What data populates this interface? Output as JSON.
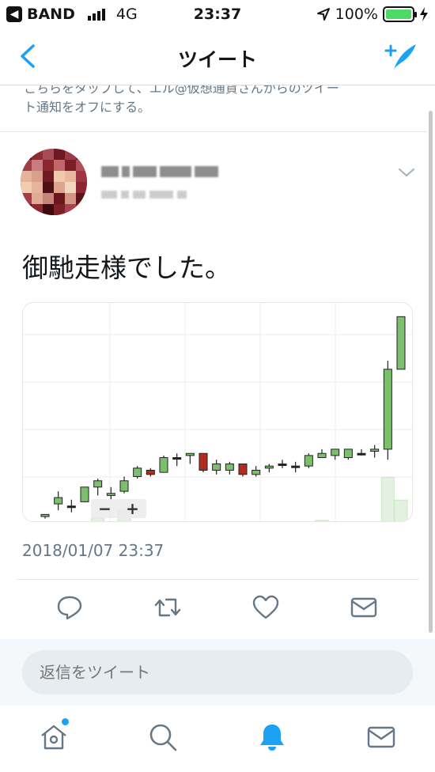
{
  "status_bar": {
    "carrier": "BAND",
    "network": "4G",
    "time": "23:37",
    "battery": "100%"
  },
  "nav": {
    "title": "ツイート"
  },
  "cut_notice": {
    "line1": "こちらをタップして、エル@仮想通貨さんからのツイー",
    "line2": "ト通知をオフにする。"
  },
  "tweet": {
    "text": "御馳走様でした。",
    "timestamp": "2018/01/07 23:37"
  },
  "chart": {
    "zoom_minus": "−",
    "zoom_plus": "+"
  },
  "chart_data": {
    "type": "candlestick",
    "candles": [
      {
        "o": 3,
        "c": 4,
        "h": 4,
        "l": 2,
        "dir": "up"
      },
      {
        "o": 9,
        "c": 12,
        "h": 15,
        "l": 6,
        "dir": "up"
      },
      {
        "o": 8,
        "c": 8,
        "h": 11,
        "l": 5,
        "dir": "flat"
      },
      {
        "o": 10,
        "c": 17,
        "h": 17,
        "l": 10,
        "dir": "up"
      },
      {
        "o": 17,
        "c": 20,
        "h": 21,
        "l": 13,
        "dir": "up"
      },
      {
        "o": 13,
        "c": 14,
        "h": 17,
        "l": 11,
        "dir": "up"
      },
      {
        "o": 15,
        "c": 20,
        "h": 22,
        "l": 14,
        "dir": "up"
      },
      {
        "o": 22,
        "c": 26,
        "h": 27,
        "l": 21,
        "dir": "up"
      },
      {
        "o": 25,
        "c": 23,
        "h": 26,
        "l": 22,
        "dir": "down"
      },
      {
        "o": 24,
        "c": 31,
        "h": 32,
        "l": 24,
        "dir": "up"
      },
      {
        "o": 31,
        "c": 31,
        "h": 33,
        "l": 27,
        "dir": "flat"
      },
      {
        "o": 32,
        "c": 33,
        "h": 33,
        "l": 28,
        "dir": "up"
      },
      {
        "o": 33,
        "c": 25,
        "h": 33,
        "l": 24,
        "dir": "down"
      },
      {
        "o": 25,
        "c": 28,
        "h": 30,
        "l": 23,
        "dir": "up"
      },
      {
        "o": 25,
        "c": 28,
        "h": 29,
        "l": 23,
        "dir": "up"
      },
      {
        "o": 28,
        "c": 23,
        "h": 28,
        "l": 22,
        "dir": "down"
      },
      {
        "o": 23,
        "c": 25,
        "h": 27,
        "l": 22,
        "dir": "up"
      },
      {
        "o": 26,
        "c": 27,
        "h": 28,
        "l": 24,
        "dir": "up"
      },
      {
        "o": 28,
        "c": 28,
        "h": 30,
        "l": 26,
        "dir": "flat"
      },
      {
        "o": 27,
        "c": 27,
        "h": 29,
        "l": 24,
        "dir": "flat"
      },
      {
        "o": 27,
        "c": 32,
        "h": 33,
        "l": 26,
        "dir": "up"
      },
      {
        "o": 31,
        "c": 33,
        "h": 35,
        "l": 31,
        "dir": "up"
      },
      {
        "o": 32,
        "c": 35,
        "h": 35,
        "l": 30,
        "dir": "up"
      },
      {
        "o": 31,
        "c": 35,
        "h": 35,
        "l": 30,
        "dir": "up"
      },
      {
        "o": 33,
        "c": 33,
        "h": 35,
        "l": 32,
        "dir": "flat"
      },
      {
        "o": 34,
        "c": 35,
        "h": 37,
        "l": 31,
        "dir": "up"
      },
      {
        "o": 35,
        "c": 73,
        "h": 77,
        "l": 30,
        "dir": "up"
      },
      {
        "o": 73,
        "c": 98,
        "h": 98,
        "l": 73,
        "dir": "up"
      }
    ],
    "volume": [
      0,
      0,
      0,
      0,
      2,
      0,
      5,
      0,
      0,
      0,
      0,
      0,
      0,
      0,
      0,
      0,
      0,
      0,
      0,
      0,
      0,
      1,
      0,
      0,
      0,
      0,
      18,
      9
    ],
    "grid": true,
    "colors": {
      "up": "#7cbf6c",
      "down": "#b52a1e",
      "flat": "#222222"
    }
  },
  "reply": {
    "placeholder": "返信をツイート"
  },
  "colors": {
    "accent": "#1da1f2",
    "muted": "#657786"
  }
}
